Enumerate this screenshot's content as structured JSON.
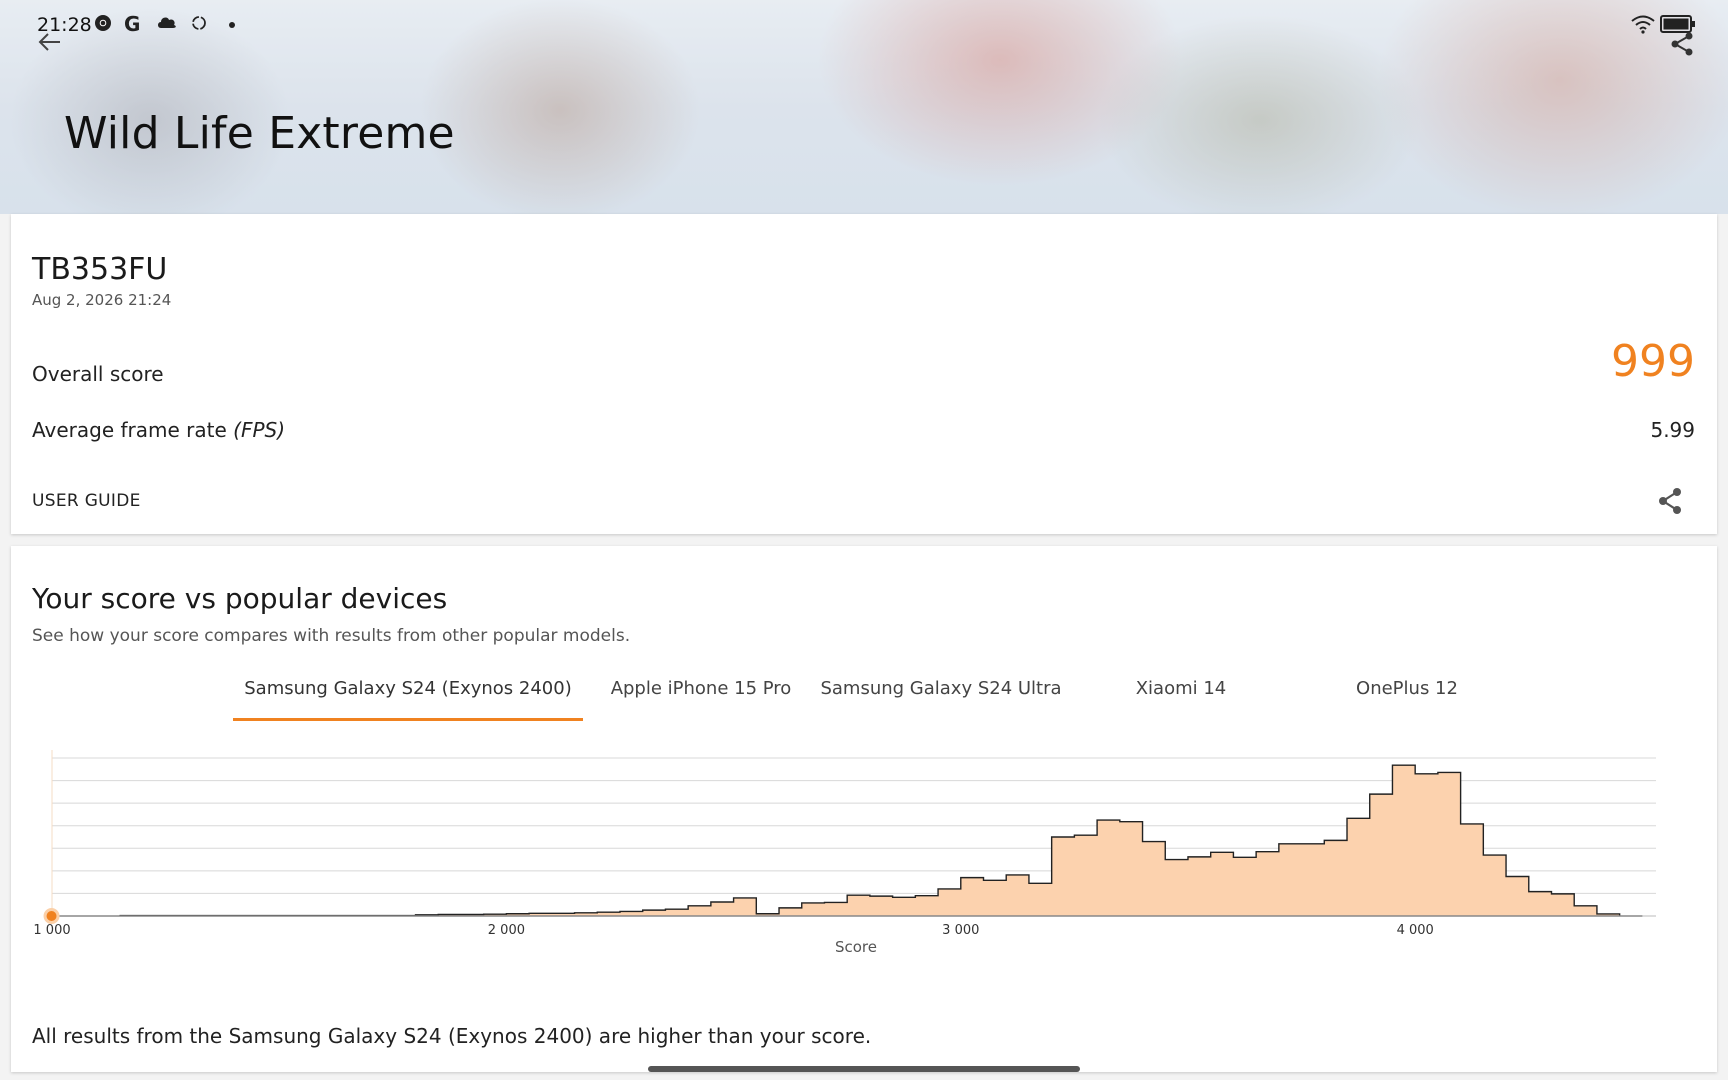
{
  "status_bar": {
    "time": "21:28",
    "left_icons": [
      "chrome-icon",
      "google-icon",
      "cloud-icon",
      "sync-icon",
      "dot-icon"
    ],
    "right_icons": [
      "wifi-icon",
      "battery-icon"
    ]
  },
  "header": {
    "title": "Wild Life Extreme"
  },
  "result": {
    "device": "TB353FU",
    "date": "Aug 2, 2026 21:24",
    "overall_label": "Overall score",
    "overall_value": "999",
    "fps_label_prefix": "Average frame rate ",
    "fps_label_unit": "(FPS)",
    "fps_value": "5.99",
    "user_guide": "USER GUIDE"
  },
  "comparison": {
    "title": "Your score vs popular devices",
    "subtitle": "See how your score compares with results from other popular models.",
    "tabs": [
      "Samsung Galaxy S24 (Exynos 2400)",
      "Apple iPhone 15 Pro",
      "Samsung Galaxy S24 Ultra",
      "Xiaomi 14",
      "OnePlus 12"
    ],
    "active_tab": 0,
    "note": "All results from the Samsung Galaxy S24 (Exynos 2400) are higher than your score."
  },
  "colors": {
    "accent": "#f08220",
    "fill": "#fcd2ae",
    "stroke": "#222222"
  },
  "chart_data": {
    "type": "area",
    "xlabel": "Score",
    "xlim": [
      1000,
      4530
    ],
    "ylim": [
      0,
      7
    ],
    "x_ticks": [
      1000,
      2000,
      3000,
      4000
    ],
    "x_tick_labels": [
      "1 000",
      "2 000",
      "3 000",
      "4 000"
    ],
    "grid": true,
    "user_score": 999,
    "bin_width": 50,
    "bins_start": 1000,
    "counts": [
      0,
      0,
      0,
      0.02,
      0.02,
      0.02,
      0.02,
      0.02,
      0.02,
      0.02,
      0.02,
      0.02,
      0.02,
      0.02,
      0.02,
      0.02,
      0.05,
      0.07,
      0.07,
      0.08,
      0.1,
      0.12,
      0.12,
      0.14,
      0.17,
      0.2,
      0.26,
      0.3,
      0.45,
      0.62,
      0.8,
      0.1,
      0.36,
      0.58,
      0.6,
      0.92,
      0.88,
      0.83,
      0.9,
      1.2,
      1.7,
      1.58,
      1.82,
      1.45,
      3.5,
      3.58,
      4.25,
      4.18,
      3.3,
      2.5,
      2.62,
      2.82,
      2.6,
      2.85,
      3.2,
      3.2,
      3.35,
      4.33,
      5.4,
      6.68,
      6.3,
      6.36,
      4.08,
      2.7,
      1.75,
      1.08,
      0.98,
      0.45,
      0.09,
      0
    ]
  }
}
